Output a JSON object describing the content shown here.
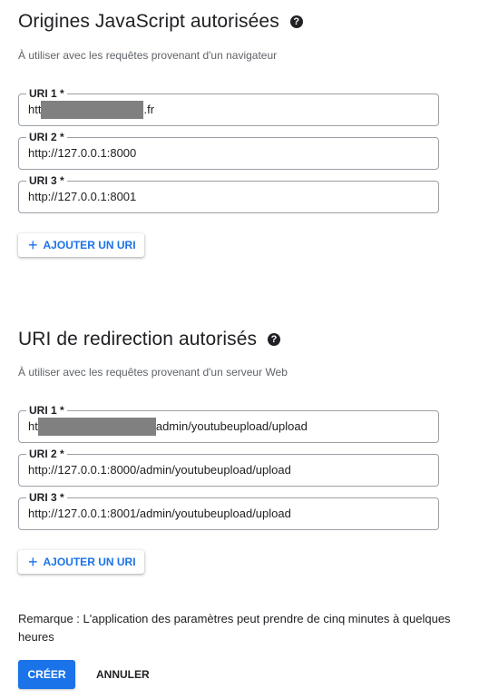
{
  "js_origins": {
    "title": "Origines JavaScript autorisées",
    "help_icon": "help-circle-icon",
    "help_glyph": "?",
    "description": "À utiliser avec les requêtes provenant d'un navigateur",
    "uris": [
      {
        "label": "URI 1 *",
        "value_prefix": "htt",
        "value_suffix": ".fr",
        "redacted": true
      },
      {
        "label": "URI 2 *",
        "value": "http://127.0.0.1:8000"
      },
      {
        "label": "URI 3 *",
        "value": "http://127.0.0.1:8001"
      }
    ],
    "add_label": "AJOUTER UN URI",
    "add_icon": "plus-icon",
    "add_glyph": "+"
  },
  "redirect_uris": {
    "title": "URI de redirection autorisés",
    "help_icon": "help-circle-icon",
    "help_glyph": "?",
    "description": "À utiliser avec les requêtes provenant d'un serveur Web",
    "uris": [
      {
        "label": "URI 1 *",
        "value_prefix": "ht",
        "value_suffix": "admin/youtubeupload/upload",
        "redacted": true
      },
      {
        "label": "URI 2 *",
        "value": "http://127.0.0.1:8000/admin/youtubeupload/upload"
      },
      {
        "label": "URI 3 *",
        "value": "http://127.0.0.1:8001/admin/youtubeupload/upload"
      }
    ],
    "add_label": "AJOUTER UN URI",
    "add_icon": "plus-icon",
    "add_glyph": "+"
  },
  "note": "Remarque : L'application des paramètres peut prendre de cinq minutes à quelques heures",
  "actions": {
    "create_label": "CRÉER",
    "cancel_label": "ANNULER"
  },
  "colors": {
    "primary": "#1a73e8",
    "text": "#202124",
    "secondary_text": "#5f6368",
    "border": "#9aa0a6",
    "redaction": "#808080"
  }
}
